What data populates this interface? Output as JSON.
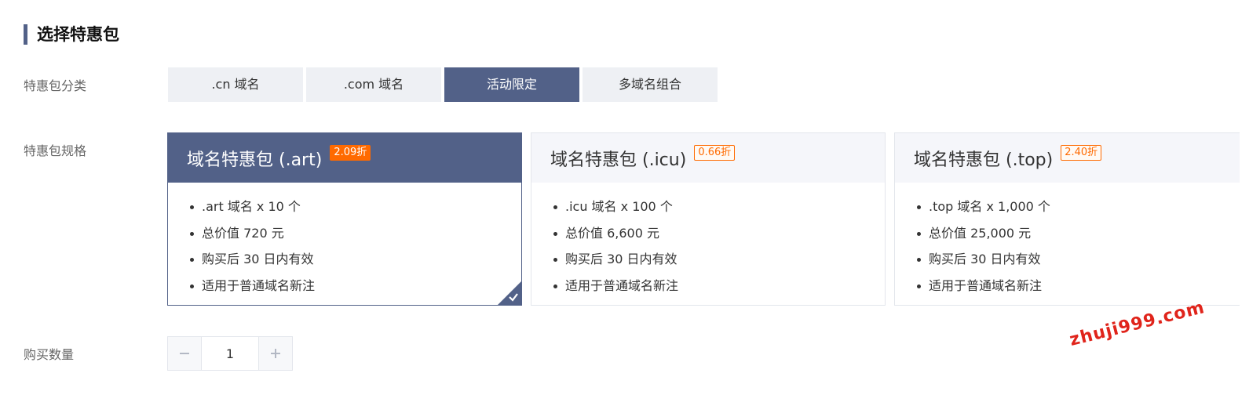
{
  "page": {
    "title": "选择特惠包"
  },
  "category": {
    "label": "特惠包分类",
    "tabs": [
      {
        "label": ".cn 域名",
        "active": false
      },
      {
        "label": ".com 域名",
        "active": false
      },
      {
        "label": "活动限定",
        "active": true
      },
      {
        "label": "多域名组合",
        "active": false
      }
    ]
  },
  "spec": {
    "label": "特惠包规格",
    "cards": [
      {
        "title": "域名特惠包 (.art)",
        "discount": "2.09折",
        "selected": true,
        "features": [
          ".art 域名 x 10 个",
          "总价值 720 元",
          "购买后 30 日内有效",
          "适用于普通域名新注"
        ]
      },
      {
        "title": "域名特惠包 (.icu)",
        "discount": "0.66折",
        "selected": false,
        "features": [
          ".icu 域名 x 100 个",
          "总价值 6,600 元",
          "购买后 30 日内有效",
          "适用于普通域名新注"
        ]
      },
      {
        "title": "域名特惠包 (.top)",
        "discount": "2.40折",
        "selected": false,
        "features": [
          ".top 域名 x 1,000 个",
          "总价值 25,000 元",
          "购买后 30 日内有效",
          "适用于普通域名新注"
        ]
      }
    ]
  },
  "quantity": {
    "label": "购买数量",
    "value": "1"
  },
  "watermark": "zhuji999.com",
  "colors": {
    "accent": "#526188",
    "badge": "#ff6a00",
    "watermark": "#e0241b"
  }
}
